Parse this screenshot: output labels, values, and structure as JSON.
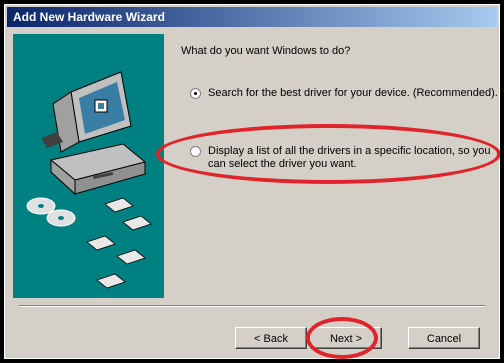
{
  "window": {
    "title": "Add New Hardware Wizard"
  },
  "content": {
    "question": "What do you want Windows to do?",
    "options": [
      {
        "label": "Search for the best driver for your device. (Recommended).",
        "selected": true
      },
      {
        "label": "Display a list of all the drivers in a specific location, so you can select the driver you want.",
        "selected": false
      }
    ]
  },
  "buttons": {
    "back": "< Back",
    "next": "Next >",
    "cancel": "Cancel"
  },
  "colors": {
    "title_bar_start": "#0a246a",
    "title_bar_end": "#a6caf0",
    "highlight_annotation": "#e0242a",
    "art_background": "#008080"
  },
  "icons": [
    "computer-icon",
    "cd-disc-icon",
    "floppy-disk-icon"
  ]
}
